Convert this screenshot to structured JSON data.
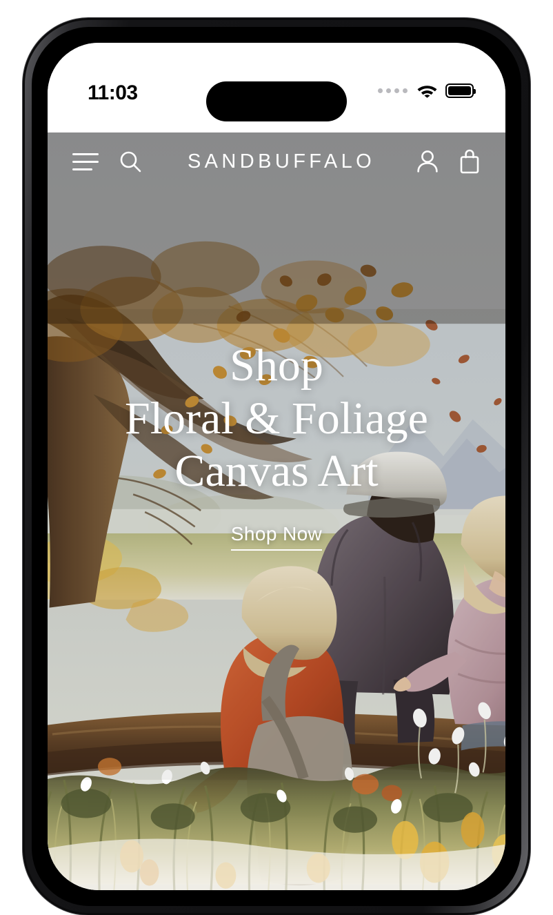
{
  "device": {
    "frame": "iphone-pro",
    "bezel_color": "#0b0b0c",
    "page_background": "#ffffff"
  },
  "status_bar": {
    "time": "11:03",
    "cellular_icon": "cellular-dots-icon",
    "wifi_icon": "wifi-icon",
    "battery_icon": "battery-full-icon",
    "battery_level_percent": 100,
    "background": "#ffffff",
    "text_color": "#000000"
  },
  "site_header": {
    "menu_icon": "hamburger-menu-icon",
    "search_icon": "search-icon",
    "brand": "SANDBUFFALO",
    "account_icon": "user-account-icon",
    "cart_icon": "shopping-bag-icon",
    "icon_color": "#ffffff"
  },
  "hero": {
    "heading_lines": [
      "Shop",
      "Floral & Foliage",
      "Canvas Art"
    ],
    "cta_label": "Shop Now",
    "text_color": "#ffffff",
    "artwork": {
      "style": "watercolor painting",
      "subject": "grandfather and two children seated on a wooden bench under an autumn tree, viewed from behind, overlooking a meadow",
      "palette": {
        "sky": "#c6cdd2",
        "tree_foliage": "#c08a36",
        "tree_trunk": "#4a3524",
        "meadow": "#9aa06a",
        "bench": "#6a4a31",
        "jacket_center": "#5f5560",
        "jacket_left_child": "#c0512a",
        "jacket_right_child": "#c2a3ab",
        "wildflower": "#ffffff",
        "accent_gold": "#d9a23a"
      }
    }
  }
}
